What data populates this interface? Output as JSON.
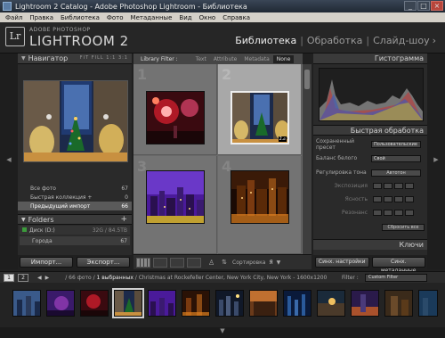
{
  "window": {
    "title": "Lightroom 2 Catalog - Adobe Photoshop Lightroom - Библиотека",
    "minimize": "_",
    "maximize": "□",
    "close": "×"
  },
  "menu": [
    "Файл",
    "Правка",
    "Библиотека",
    "Фото",
    "Метаданные",
    "Вид",
    "Окно",
    "Справка"
  ],
  "identity": {
    "logo": "Lr",
    "brand_small": "ADOBE PHOTOSHOP",
    "brand_large": "LIGHTROOM 2",
    "modules": [
      "Библиотека",
      "Обработка",
      "Слайд-шоу"
    ],
    "active_module": "Библиотека",
    "more": "›"
  },
  "left_panel": {
    "navigator_title": "Навигатор",
    "zoom_options": "FIT  FILL  1:1  3:1",
    "catalog": [
      {
        "label": "Все фото",
        "count": "67"
      },
      {
        "label": "Быстрая коллекция +",
        "count": "0"
      },
      {
        "label": "Предыдущий импорт",
        "count": "66"
      }
    ],
    "folders_title": "Folders",
    "add": "+",
    "volume": {
      "label": "Диск (D:)",
      "info": "32G / 84.5TB"
    },
    "folder": {
      "label": "Города",
      "count": "67"
    },
    "import_label": "Импорт...",
    "export_label": "Экспорт..."
  },
  "filter_bar": {
    "label": "Library Filter :",
    "options": [
      "Text",
      "Attribute",
      "Metadata",
      "None"
    ],
    "active": "None"
  },
  "grid": {
    "cells": [
      {
        "num": "1",
        "selected": false
      },
      {
        "num": "2",
        "selected": true
      },
      {
        "num": "3",
        "selected": false
      },
      {
        "num": "4",
        "selected": false
      }
    ],
    "selected_badge": "2⊿"
  },
  "toolbar": {
    "sort_label": "Сортировка",
    "sort_value": "Я"
  },
  "right_panel": {
    "histogram_title": "Гистограмма",
    "quick_develop_title": "Быстрая обработка",
    "saved_preset_label": "Сохраненный пресет",
    "saved_preset_value": "Пользовательские",
    "wb_label": "Баланс белого",
    "wb_value": "Свой",
    "tone_label": "Регулировка тона",
    "tone_value": "Автотон",
    "exposure_label": "Экспозиция",
    "clarity_label": "Ясность",
    "vibrance_label": "Резонанс",
    "reset_label": "Сбросить все",
    "keywords_title": "Ключи",
    "sync_settings_label": "Синх. настройки",
    "sync_metadata_label": "Синх. метаданные"
  },
  "filmstrip_bar": {
    "pages": [
      "1",
      "2"
    ],
    "active_page": "1",
    "path_prefix": "/ 66 фото /",
    "path_selected": "1 выбранных",
    "path_suffix": "/ Christmas at Rockefeller Center, New York City, New York - 1600x1200",
    "filter_label": "Filter :",
    "filter_value": "Custom Filter"
  },
  "bottom_arrow": "▼",
  "colors": {
    "panel": "#2a2a2a",
    "grid": "#696969",
    "selected_cell": "#a8a8a8",
    "accent": "#d8d8d8"
  }
}
